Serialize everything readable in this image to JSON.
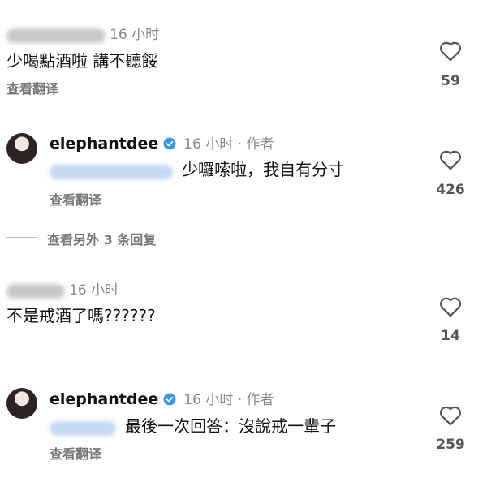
{
  "comments": [
    {
      "username_blurred": true,
      "time": "16 小时",
      "text": "少喝點酒啦 講不聽餒",
      "translate": "查看翻译",
      "likes": "59"
    },
    {
      "username": "elephantdee",
      "time": "16 小时 · 作者",
      "mention_blurred": true,
      "text": "少囉嗦啦，我自有分寸",
      "translate": "查看翻译",
      "likes": "426",
      "verified": true
    },
    {
      "more_replies": "查看另外 3 条回复"
    },
    {
      "username_blurred": true,
      "time": "16 小时",
      "text": "不是戒酒了嗎??????",
      "likes": "14"
    },
    {
      "username": "elephantdee",
      "time": "16 小时 · 作者",
      "mention_blurred": true,
      "text": "最後一次回答：沒說戒一輩子",
      "translate": "查看翻译",
      "likes": "259",
      "verified": true
    }
  ],
  "icons": {
    "like": "heart-outline-icon",
    "verified": "verified-badge-icon"
  },
  "colors": {
    "verified": "#3897f0",
    "heart_stroke": "#555555"
  }
}
